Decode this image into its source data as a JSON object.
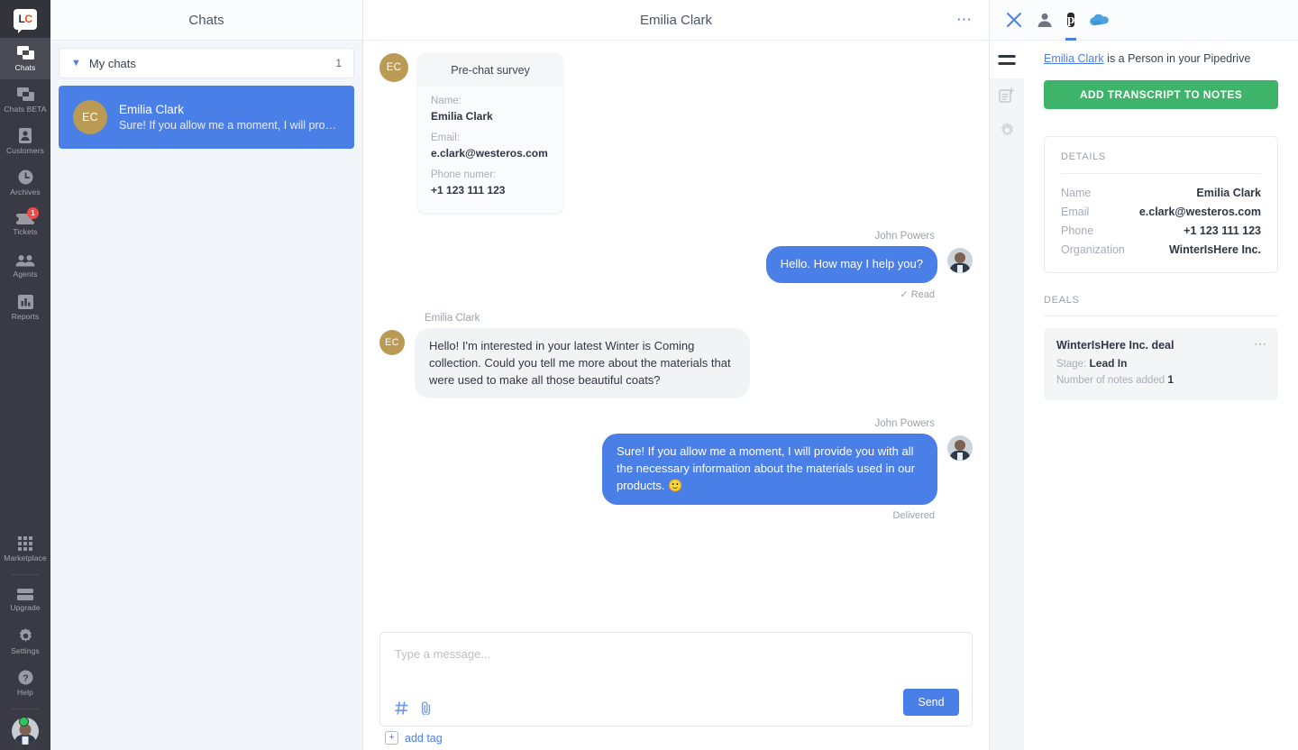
{
  "nav": {
    "logo": "LC",
    "items": [
      {
        "label": "Chats",
        "icon": "chat-icon",
        "active": true,
        "badge": null
      },
      {
        "label": "Chats BETA",
        "icon": "chat-beta-icon",
        "active": false,
        "badge": null
      },
      {
        "label": "Customers",
        "icon": "customers-icon",
        "active": false,
        "badge": null
      },
      {
        "label": "Archives",
        "icon": "clock-icon",
        "active": false,
        "badge": null
      },
      {
        "label": "Tickets",
        "icon": "ticket-icon",
        "active": false,
        "badge": "1"
      },
      {
        "label": "Agents",
        "icon": "agents-icon",
        "active": false,
        "badge": null
      },
      {
        "label": "Reports",
        "icon": "reports-icon",
        "active": false,
        "badge": null
      }
    ],
    "bottom_items": [
      {
        "label": "Marketplace",
        "icon": "grid-icon"
      },
      {
        "label": "Upgrade",
        "icon": "card-icon"
      },
      {
        "label": "Settings",
        "icon": "gear-icon"
      },
      {
        "label": "Help",
        "icon": "help-icon"
      }
    ],
    "avatar_status": "online"
  },
  "chat_list": {
    "header": "Chats",
    "group": {
      "label": "My chats",
      "count": "1"
    },
    "items": [
      {
        "initials": "EC",
        "name": "Emilia Clark",
        "preview": "Sure! If you allow me a moment, I will provid...",
        "selected": true
      }
    ]
  },
  "conversation": {
    "title": "Emilia Clark",
    "menu_icon": "ellipsis-icon",
    "survey": {
      "initials": "EC",
      "title": "Pre-chat survey",
      "fields": [
        {
          "label": "Name:",
          "value": "Emilia Clark"
        },
        {
          "label": "Email:",
          "value": "e.clark@westeros.com"
        },
        {
          "label": "Phone numer:",
          "value": "+1 123 111 123"
        }
      ]
    },
    "messages": [
      {
        "author": "John Powers",
        "side": "right",
        "text": "Hello. How may I help you?",
        "status": "Read",
        "status_icon": "check-icon"
      },
      {
        "author": "Emilia Clark",
        "side": "left",
        "initials": "EC",
        "text": "Hello! I'm interested in your latest Winter is Coming collection. Could you tell me more about the materials that were used to make all those beautiful coats?",
        "status": null
      },
      {
        "author": "John Powers",
        "side": "right",
        "text": "Sure! If you allow me a moment, I will provide you with all the necessary information about the materials used in our products. 🙂",
        "status": "Delivered",
        "status_icon": null
      }
    ],
    "composer": {
      "placeholder": "Type a message...",
      "value": "",
      "send_label": "Send",
      "tools": [
        "hash-icon",
        "attachment-icon"
      ]
    },
    "tagbar": {
      "plus": "+",
      "label": "add tag"
    }
  },
  "right_panel": {
    "top_icons": [
      {
        "name": "close-icon",
        "active": false
      },
      {
        "name": "person-icon",
        "active": false
      },
      {
        "name": "pipedrive-icon",
        "active": true,
        "letter": "p"
      },
      {
        "name": "cloud-icon",
        "active": false
      }
    ],
    "rail_icons": [
      "menu-icon",
      "add-note-icon",
      "gear-icon"
    ],
    "lead": {
      "link": "Emilia Clark",
      "rest": " is a Person in your Pipedrive"
    },
    "transcript_button": "ADD TRANSCRIPT TO NOTES",
    "details": {
      "title": "DETAILS",
      "rows": [
        {
          "key": "Name",
          "value": "Emilia Clark"
        },
        {
          "key": "Email",
          "value": "e.clark@westeros.com"
        },
        {
          "key": "Phone",
          "value": "+1 123 111 123"
        },
        {
          "key": "Organization",
          "value": "WinterIsHere Inc."
        }
      ]
    },
    "deals": {
      "title": "DEALS",
      "items": [
        {
          "name": "WinterIsHere Inc. deal",
          "stage_label": "Stage:",
          "stage_value": "Lead In",
          "notes_label": "Number of notes added",
          "notes_value": "1",
          "menu_icon": "ellipsis-icon"
        }
      ]
    }
  },
  "colors": {
    "accent_blue": "#4b7fe8",
    "green": "#3eb46a",
    "rail_dark": "#3a3a44",
    "avatar_gold": "#bb9a56",
    "badge_red": "#ef4a4a"
  }
}
